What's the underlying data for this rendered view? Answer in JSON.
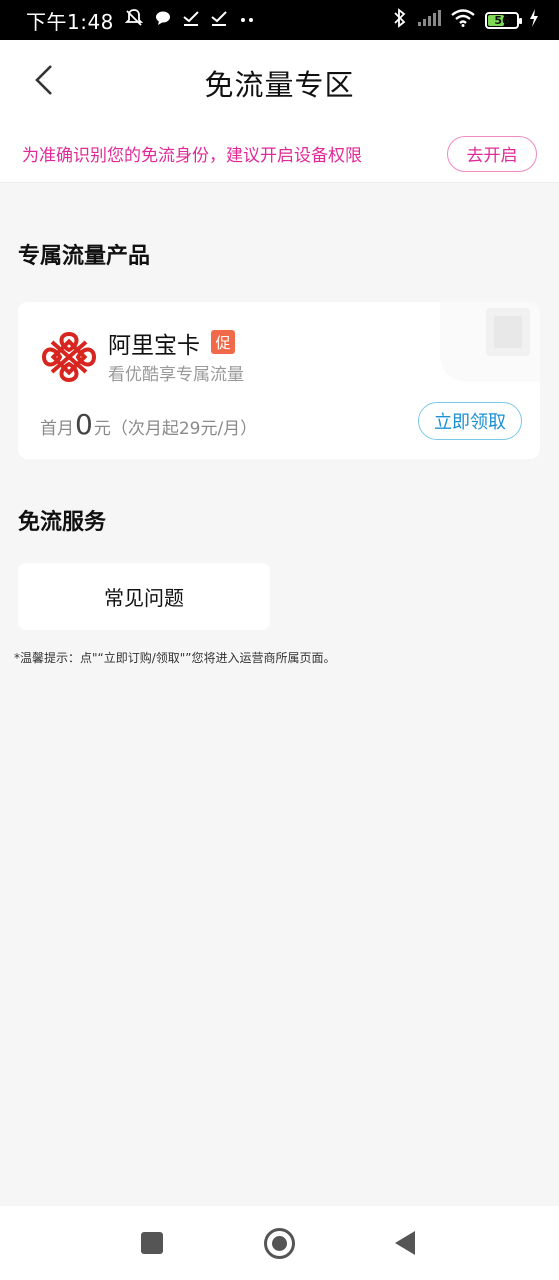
{
  "status_bar": {
    "time": "下午1:48",
    "left_icons": [
      "mute-bell-icon",
      "chat-bubble-icon",
      "check-download-icon",
      "check-download-icon",
      "more-dots-icon"
    ],
    "battery": "56",
    "battery_level": 0.56
  },
  "header": {
    "title": "免流量专区",
    "back_icon": "chevron-left-icon"
  },
  "banner": {
    "text": "为准确识别您的免流身份，建议开启设备权限",
    "button": "去开启"
  },
  "products_section": {
    "title": "专属流量产品"
  },
  "product": {
    "name": "阿里宝卡",
    "badge": "促",
    "description": "看优酷享专属流量",
    "price_prefix": "首月",
    "price_amount": "0",
    "price_suffix": "元（次月起29元/月）",
    "claim_button": "立即领取",
    "logo_icon": "china-unicom-logo"
  },
  "services_section": {
    "title": "免流服务",
    "faq": "常见问题"
  },
  "tip": "*温馨提示：点\"“立即订购/领取\"”您将进入运营商所属页面。",
  "colors": {
    "accent_pink": "#e02a98",
    "accent_blue": "#1d8fd3",
    "promo_orange": "#f06a4a",
    "logo_red": "#d7261f"
  }
}
